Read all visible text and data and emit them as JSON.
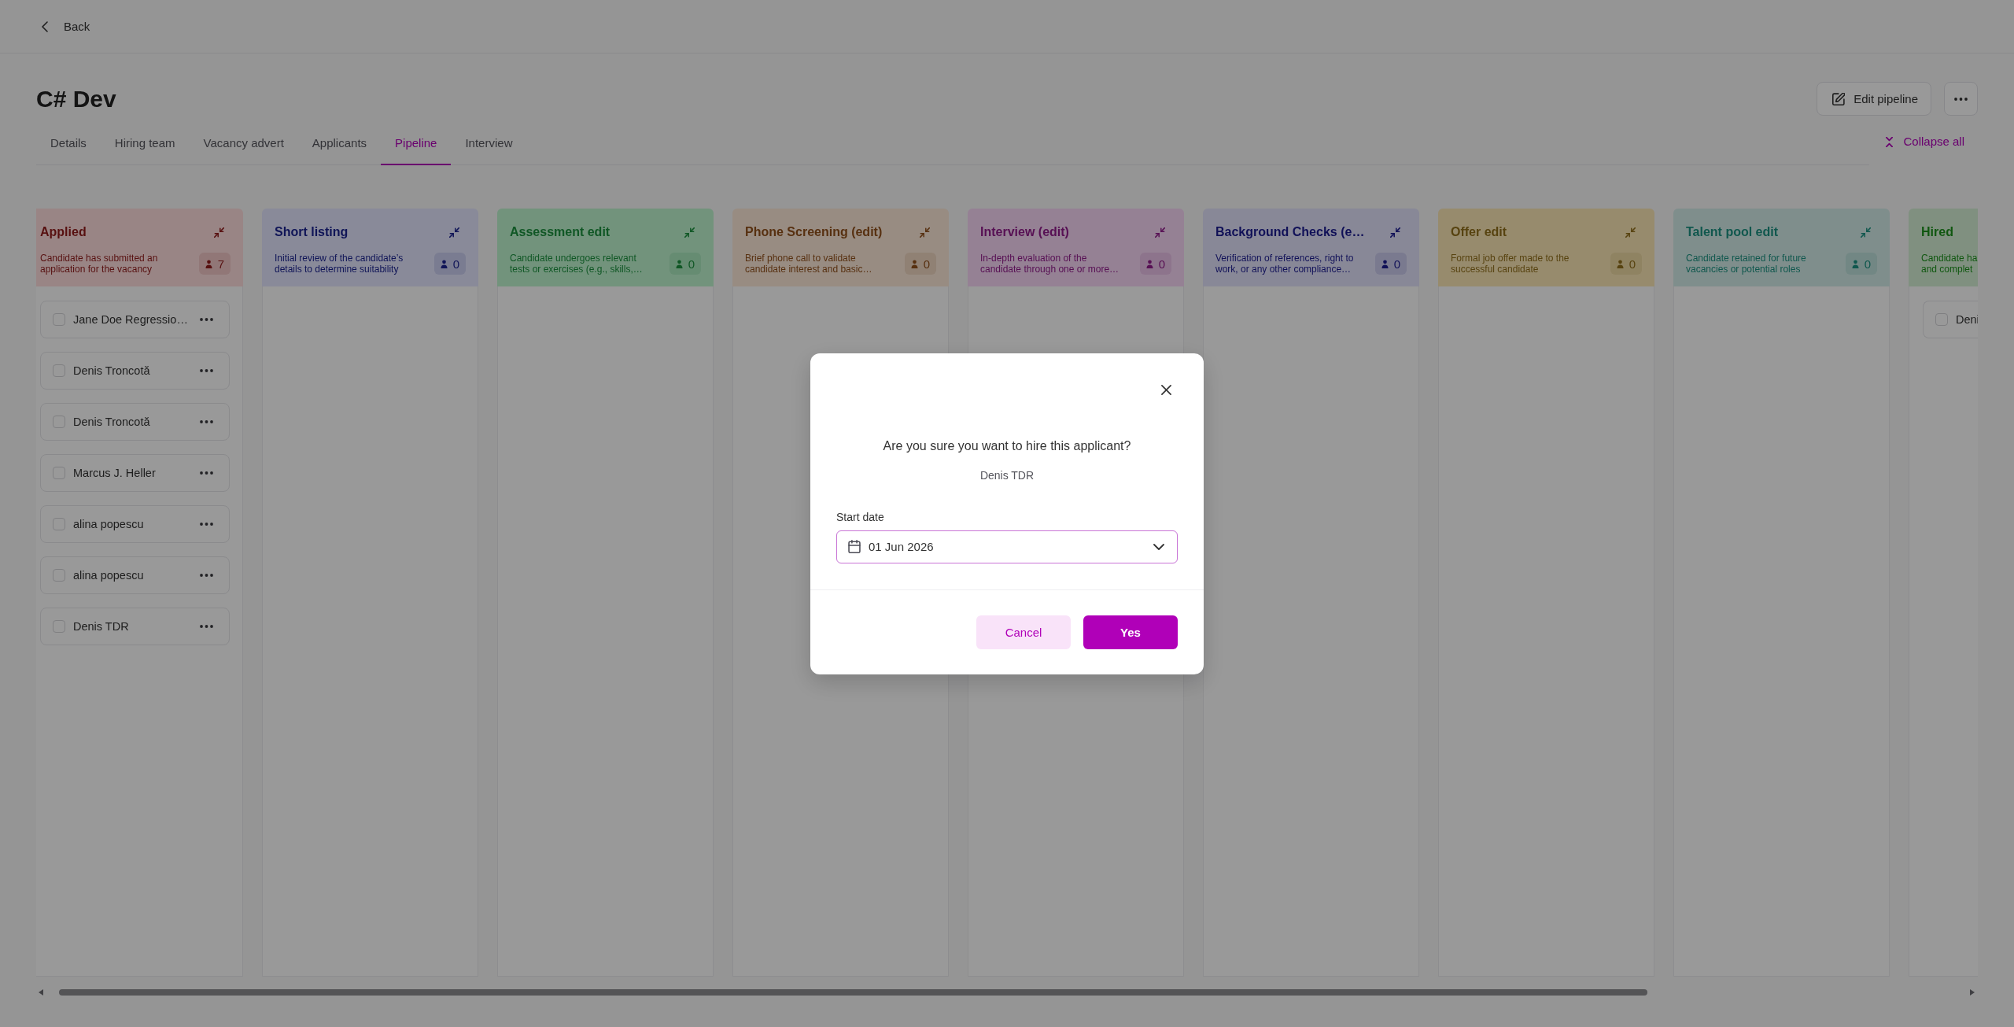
{
  "top_bar": {
    "back_label": "Back"
  },
  "header": {
    "title": "C# Dev",
    "edit_button": "Edit pipeline"
  },
  "tabs": [
    {
      "label": "Details",
      "selected": false
    },
    {
      "label": "Hiring team",
      "selected": false
    },
    {
      "label": "Vacancy advert",
      "selected": false
    },
    {
      "label": "Applicants",
      "selected": false
    },
    {
      "label": "Pipeline",
      "selected": true
    },
    {
      "label": "Interview",
      "selected": false
    }
  ],
  "collapse_all": {
    "label": "Collapse all"
  },
  "columns": [
    {
      "title": "Applied",
      "description": "Candidate has submitted an\napplication for the vacancy",
      "count": "7",
      "color": "#998585",
      "collapse_icon": true,
      "cards": [
        {
          "name": "Jane Doe Regressio…",
          "checked": false,
          "has_menu": true
        },
        {
          "name": "Denis Troncotă",
          "checked": false,
          "has_menu": true
        },
        {
          "name": "Denis Troncotă",
          "checked": false,
          "has_menu": true
        },
        {
          "name": "Marcus J. Heller",
          "checked": false,
          "has_menu": true
        },
        {
          "name": "alina popescu",
          "checked": false,
          "has_menu": true
        },
        {
          "name": "alina popescu",
          "checked": false,
          "has_menu": true
        },
        {
          "name": "Denis TDR",
          "checked": false,
          "has_menu": true
        }
      ]
    },
    {
      "title": "Short listing",
      "description": "Initial review of the candidate’s\ndetails to determine suitability",
      "count": "0",
      "color": "#898a99",
      "collapse_icon": true
    },
    {
      "title": "Assessment edit",
      "description": "Candidate undergoes relevant\ntests or exercises (e.g., skills,…",
      "count": "0",
      "color": "#72937c",
      "collapse_icon": true
    },
    {
      "title": "Phone Screening (edit)",
      "description": "Brief phone call to validate\ncandidate interest and basic…",
      "count": "0",
      "color": "#988c82",
      "collapse_icon": true
    },
    {
      "title": "Interview (edit)",
      "description": "In-depth evaluation of the\ncandidate through one or more…",
      "count": "0",
      "color": "#958194",
      "collapse_icon": true
    },
    {
      "title": "Background Checks (e…",
      "description": "Verification of references, right to\nwork, or any other compliance…",
      "count": "0",
      "color": "#888897",
      "collapse_icon": true
    },
    {
      "title": "Offer edit",
      "description": "Formal job offer made to the\nsuccessful candidate",
      "count": "0",
      "color": "#978b6d",
      "collapse_icon": true
    },
    {
      "title": "Talent pool edit",
      "description": "Candidate retained for future\nvacancies or potential roles",
      "count": "0",
      "color": "#7f8e8c",
      "collapse_icon": true
    },
    {
      "title": "Hired",
      "description": "Candidate ha\nand complet",
      "color": "#809080",
      "collapse_icon": false,
      "cards": [
        {
          "name": "Deni",
          "checked": false,
          "has_menu": false
        }
      ]
    }
  ],
  "dialog": {
    "title": "Are you sure you want to hire this applicant?",
    "applicant": "Denis TDR",
    "start_date": {
      "label": "Start date",
      "value": "01 Jun 2026"
    },
    "buttons": [
      {
        "label": "Cancel",
        "kind": "secondary"
      },
      {
        "label": "Yes",
        "kind": "primary"
      }
    ]
  }
}
